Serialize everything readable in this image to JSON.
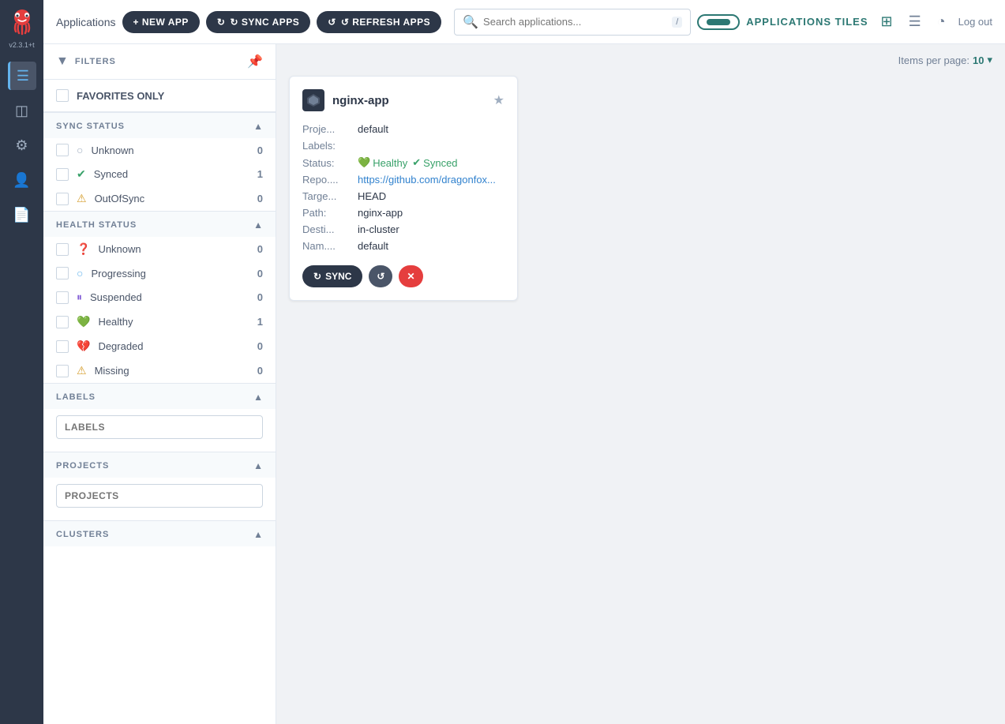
{
  "sidebar": {
    "version": "v2.3.1+t",
    "items": [
      {
        "id": "home",
        "icon": "🐙",
        "label": "Home",
        "active": false
      },
      {
        "id": "apps",
        "icon": "⊞",
        "label": "Applications",
        "active": true
      },
      {
        "id": "settings",
        "icon": "⚙",
        "label": "Settings",
        "active": false
      },
      {
        "id": "user",
        "icon": "👤",
        "label": "User",
        "active": false
      },
      {
        "id": "docs",
        "icon": "📄",
        "label": "Docs",
        "active": false
      }
    ]
  },
  "topbar": {
    "title": "Applications",
    "page_title": "APPLICATIONS TILES",
    "buttons": {
      "new_app": "+ NEW APP",
      "sync_apps": "↻ SYNC APPS",
      "refresh_apps": "↺ REFRESH APPS"
    },
    "search": {
      "placeholder": "Search applications...",
      "kbd": "/"
    },
    "logout": "Log out",
    "items_per_page_label": "Items per page:",
    "items_per_page_value": "10"
  },
  "filters": {
    "header": "FILTERS",
    "favorites_only": "FAVORITES ONLY",
    "sync_status": {
      "title": "SYNC STATUS",
      "items": [
        {
          "name": "Unknown",
          "count": 0,
          "icon": "❓",
          "color": "#a0aec0"
        },
        {
          "name": "Synced",
          "count": 1,
          "icon": "✅",
          "color": "#38a169"
        },
        {
          "name": "OutOfSync",
          "count": 0,
          "icon": "⚠",
          "color": "#d69e2e"
        }
      ]
    },
    "health_status": {
      "title": "HEALTH STATUS",
      "items": [
        {
          "name": "Unknown",
          "count": 0,
          "icon": "❓",
          "color": "#a0aec0"
        },
        {
          "name": "Progressing",
          "count": 0,
          "icon": "○",
          "color": "#63b3ed"
        },
        {
          "name": "Suspended",
          "count": 0,
          "icon": "⏸",
          "color": "#805ad5"
        },
        {
          "name": "Healthy",
          "count": 1,
          "icon": "💚",
          "color": "#38a169"
        },
        {
          "name": "Degraded",
          "count": 0,
          "icon": "💔",
          "color": "#e53e3e"
        },
        {
          "name": "Missing",
          "count": 0,
          "icon": "⚠",
          "color": "#d69e2e"
        }
      ]
    },
    "labels": {
      "title": "LABELS",
      "placeholder": "LABELS"
    },
    "projects": {
      "title": "PROJECTS",
      "placeholder": "PROJECTS"
    },
    "clusters": {
      "title": "CLUSTERS"
    }
  },
  "app_card": {
    "name": "nginx-app",
    "project": "default",
    "labels": "",
    "status": {
      "health": "Healthy",
      "sync": "Synced"
    },
    "repo": "https://github.com/dragonfox...",
    "target": "HEAD",
    "path": "nginx-app",
    "destination": "in-cluster",
    "namespace": "default",
    "actions": {
      "sync": "SYNC",
      "refresh": "↺",
      "delete": "✕"
    }
  }
}
